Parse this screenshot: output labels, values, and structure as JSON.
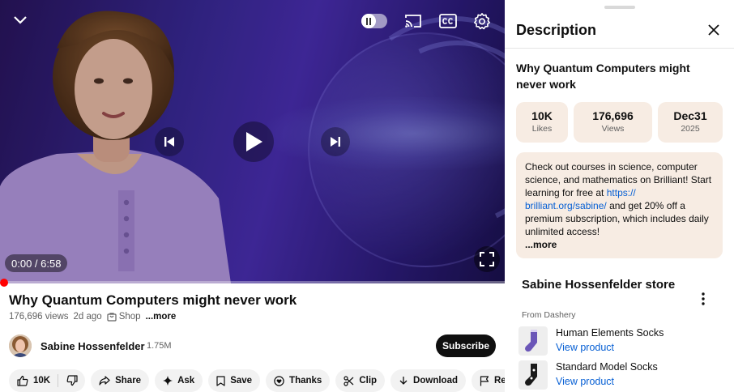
{
  "player": {
    "time": "0:00 / 6:58",
    "progress": 0,
    "autoplay": "on",
    "icons": [
      "chevron-down-icon",
      "pause-icon",
      "cast-icon",
      "closed-captions-icon",
      "gear-icon",
      "previous-icon",
      "play-icon",
      "next-icon",
      "fullscreen-icon"
    ]
  },
  "video": {
    "title": "Why Quantum Computers might never work",
    "views": "176,696 views",
    "age": "2d ago",
    "shop_label": "Shop",
    "more_label": "...more"
  },
  "channel": {
    "name": "Sabine Hossenfelder",
    "subscribers": "1.75M",
    "subscribe_label": "Subscribe"
  },
  "actions": {
    "likes": "10K",
    "share": "Share",
    "ask": "Ask",
    "save": "Save",
    "thanks": "Thanks",
    "clip": "Clip",
    "download": "Download",
    "report": "Report"
  },
  "description": {
    "panel_title": "Description",
    "title": "Why Quantum Computers might never work",
    "stats": {
      "likes_value": "10K",
      "likes_label": "Likes",
      "views_value": "176,696",
      "views_label": "Views",
      "date_value": "Dec31",
      "date_label": "2025"
    },
    "body_before": "Check out courses in science, computer science, and mathematics on Brilliant! Start learning for free at ",
    "body_link": "https:// brilliant.org/sabine/",
    "body_after": " and get 20% off a premium subscription, which includes daily unlimited access!",
    "more_label": "...more"
  },
  "store": {
    "title": "Sabine Hossenfelder store",
    "source": "From Dashery",
    "products": [
      {
        "name": "Human Elements Socks",
        "link": "View product"
      },
      {
        "name": "Standard Model Socks",
        "link": "View product"
      }
    ]
  },
  "colors": {
    "accent_red": "#ff0000",
    "link_blue": "#065fd4",
    "subscribe_bg": "#0f0f0f",
    "card_bg": "#f7ece3",
    "chip_bg": "#f2f2f2"
  }
}
